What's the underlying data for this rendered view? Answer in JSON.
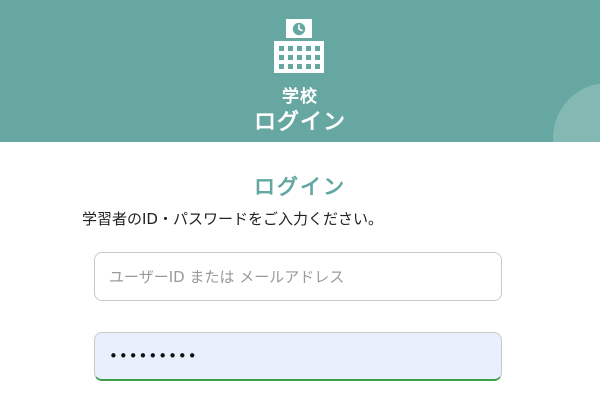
{
  "colors": {
    "header_bg": "#67a7a1",
    "accent": "#63a7a2",
    "field_focus_underline": "#3aa04a",
    "autofill_bg": "#e8f0fe"
  },
  "header": {
    "icon": "school-building-icon",
    "subtitle": "学校",
    "title": "ログイン"
  },
  "main": {
    "heading": "ログイン",
    "instructions": "学習者のID・パスワードをご入力ください。",
    "username": {
      "placeholder": "ユーザーID または メールアドレス",
      "value": ""
    },
    "password": {
      "value": "•••••••••"
    }
  }
}
